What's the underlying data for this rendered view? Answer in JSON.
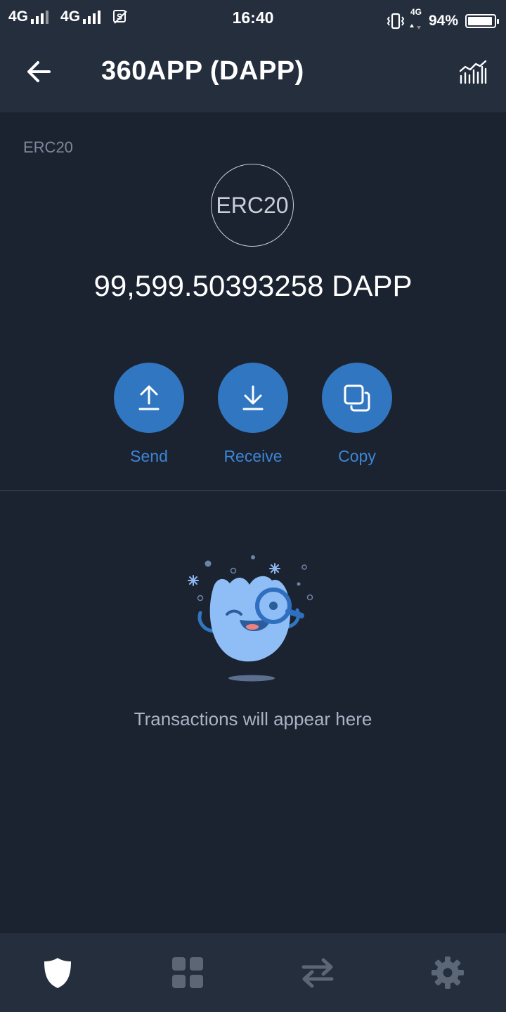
{
  "status_bar": {
    "sim1": "4G",
    "sim2": "4G",
    "time": "16:40",
    "small_network": "4G",
    "battery_percent": "94%",
    "battery_level": 0.94
  },
  "header": {
    "title": "360APP (DAPP)",
    "back_icon": "arrow-left-icon",
    "chart_icon": "chart-icon"
  },
  "token": {
    "standard_tag": "ERC20",
    "logo_text": "ERC20",
    "balance": "99,599.50393258 DAPP"
  },
  "actions": [
    {
      "label": "Send",
      "icon": "upload-arrow-icon"
    },
    {
      "label": "Receive",
      "icon": "download-arrow-icon"
    },
    {
      "label": "Copy",
      "icon": "copy-icon"
    }
  ],
  "empty_state": {
    "message": "Transactions will appear here"
  },
  "bottom_nav": [
    {
      "icon": "shield-icon",
      "active": true
    },
    {
      "icon": "grid-icon",
      "active": false
    },
    {
      "icon": "swap-arrows-icon",
      "active": false
    },
    {
      "icon": "gear-icon",
      "active": false
    }
  ],
  "colors": {
    "background": "#1b2230",
    "bar": "#242e3d",
    "accent": "#3176c1",
    "accent_text": "#3d86d6",
    "muted": "#7d889a"
  }
}
